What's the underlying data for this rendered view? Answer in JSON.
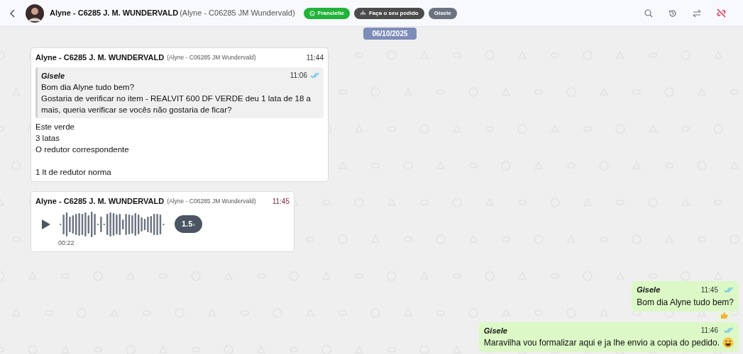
{
  "header": {
    "contact_name": "Alyne - C6285 J. M. WUNDERVALD",
    "contact_alias": "(Alyne - C06285 JM Wundervald)",
    "tags": [
      {
        "kind": "whatsapp",
        "label": "Francielle",
        "color": "#22b33a"
      },
      {
        "kind": "order",
        "label": "Faça o seu pedido",
        "color": "#4b4b4b"
      },
      {
        "kind": "plain",
        "label": "Gisele",
        "color": "#6b7280"
      }
    ]
  },
  "date_chip": "06/10/2025",
  "messages": [
    {
      "kind": "incoming",
      "sender": "Alyne - C6285 J. M. WUNDERVALD",
      "alias": "(Alyne - C06285 JM Wundervald)",
      "time": "11:44",
      "quote": {
        "sender": "Gisele",
        "time": "11:06",
        "read": true,
        "lines": [
          "Bom dia Alyne tudo bem?",
          "Gostaria de verificar no item - REALVIT 600 DF VERDE deu 1 lata de 18 a mais, queria verificar se vocês não gostaria de ficar?"
        ]
      },
      "paragraphs": [
        [
          "Este verde",
          "3 latas",
          "O redutor correspondente"
        ],
        [
          "1 lt de redutor norma"
        ]
      ]
    },
    {
      "kind": "audio",
      "sender": "Alyne - C6285 J. M. WUNDERVALD",
      "alias": "(Alyne - C06285 JM Wundervald)",
      "time": "11:45",
      "duration": "00:22",
      "speed": "1.5",
      "speed_unit": "×"
    },
    {
      "kind": "outgoing",
      "sender": "Gisele",
      "time": "11:45",
      "read": true,
      "text": "Bom dia Alyne tudo bem?",
      "reacted": true,
      "emoji_after": false
    },
    {
      "kind": "outgoing",
      "sender": "Gisele",
      "time": "11:46",
      "read": true,
      "text": "Maravilha vou formalizar aqui e ja lhe envio a copia do pedido.",
      "reacted": false,
      "emoji_after": true
    }
  ]
}
